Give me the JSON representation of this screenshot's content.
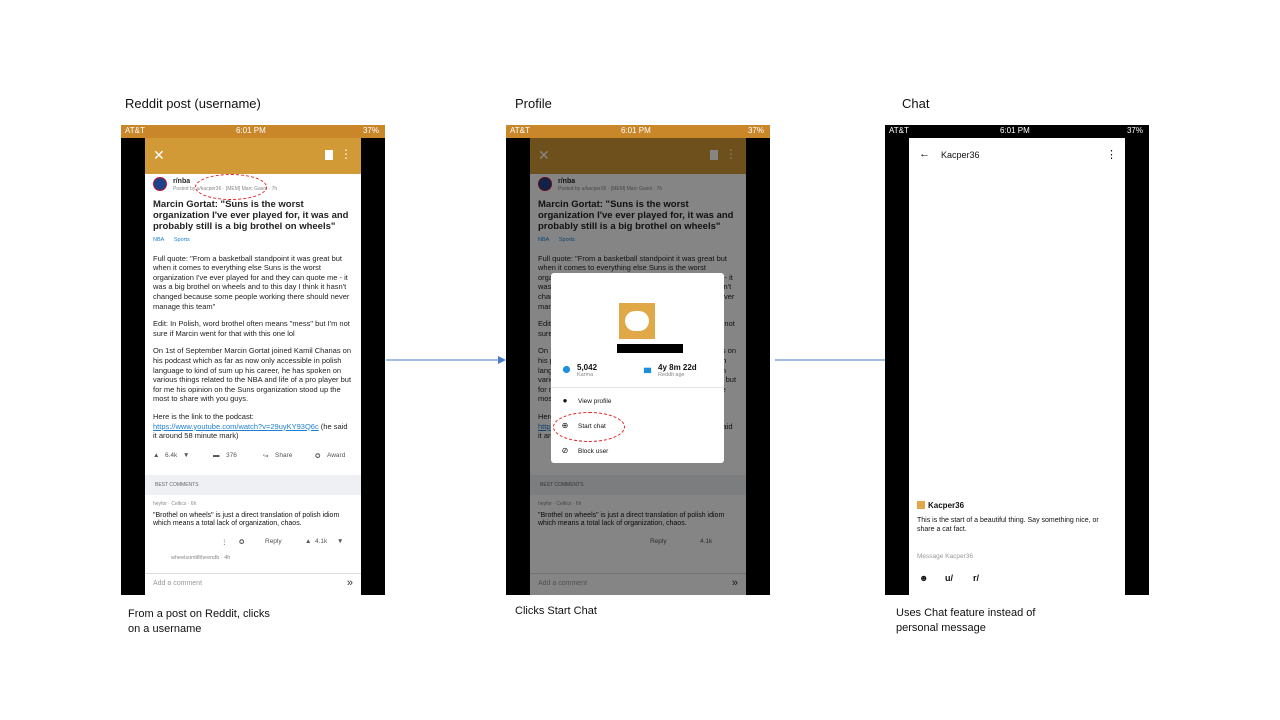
{
  "captions": {
    "left": "Reddit post (username)",
    "middle": "Profile",
    "right": "Chat"
  },
  "notes": {
    "left_line1": "From a post on Reddit, clicks",
    "left_line2": "on a username",
    "middle": "Clicks Start Chat",
    "right_line1": "Uses Chat feature instead of",
    "right_line2": "personal message"
  },
  "status_bar": {
    "carrier": "AT&T",
    "time": "6:01 PM",
    "battery": "37%"
  },
  "post": {
    "subreddit": "r/nba",
    "meta": "Posted by u/kacper36 · [MEM] Marc Gasol · 7h",
    "title": "Marcin Gortat: \"Suns is the worst organization I've ever played for, it was and probably still is a big brothel on wheels\"",
    "tags": [
      "NBA",
      "Sports"
    ],
    "para1": "Full quote: \"From a basketball standpoint it was great but when it comes to everything else Suns is the worst organization I've ever played for and they can quote me - it was a big brothel on wheels and to this day I think it hasn't changed because some people working there should never manage this team\"",
    "para2": "Edit: In Polish, word brothel often means \"mess\" but I'm not sure if Marcin went for that with this one lol",
    "para3": "On 1st of September Marcin Gortat joined Kamil Chanas on his podcast which as far as now only accessible in polish language to kind of sum up his career, he has spoken on various things related to the NBA and life of a pro player but for me his opinion on the Suns organization stood up the most to share with you guys.",
    "para4_prefix": "Here is the link to the podcast: ",
    "para4_link": "https://www.youtube.com/watch?v=29uyKY93Q6c",
    "para4_suffix": " (he said it around 58 minute mark)",
    "votes": "6.4k",
    "comments": "376",
    "share": "Share",
    "award": "Award",
    "best_comments": "BEST COMMENTS",
    "comment_meta": "heyfor · Celtics · 6h",
    "comment_text": "\"Brothel on wheels\" is just a direct translation of polish idiom which means a total lack of organization, chaos.",
    "comment_reply": "Reply",
    "comment_votes": "4.1k",
    "reply_meta": "wheelsontilltheendb · 4h",
    "add_comment": "Add a comment"
  },
  "profile_modal": {
    "karma_value": "5,042",
    "karma_label": "Karma",
    "age_value": "4y 8m 22d",
    "age_label": "Reddit age",
    "view_profile": "View profile",
    "start_chat": "Start chat",
    "block_user": "Block user"
  },
  "chat": {
    "username": "Kacper36",
    "intro": "This is the start of a beautiful thing. Say something nice, or share a cat fact.",
    "placeholder": "Message Kacper36",
    "tools": [
      "u/",
      "r/"
    ]
  },
  "colors": {
    "reddit_header": "#d19a36",
    "highlight": "#e02020",
    "arrow": "#4a7bd0",
    "link": "#1d7fd1"
  }
}
